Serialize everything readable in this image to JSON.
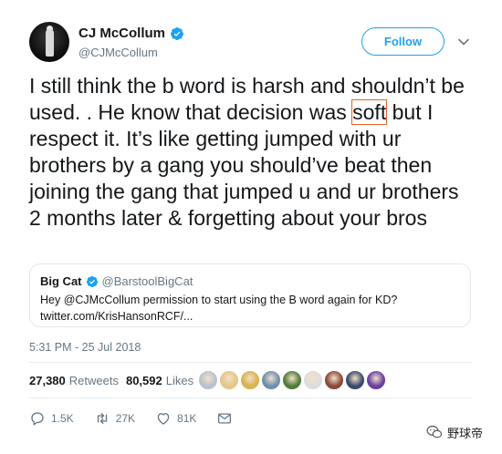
{
  "author": {
    "display_name": "CJ McCollum",
    "handle": "@CJMcCollum",
    "verified": true
  },
  "follow_button": {
    "label": "Follow"
  },
  "tweet": {
    "text_before": "I still think the b word is harsh and shouldn’t be used. . He know that decision was ",
    "highlighted_word": "soft",
    "text_after": " but I respect it. It’s like getting jumped with ur brothers by a gang you should’ve beat then joining the gang that jumped u and ur brothers 2 months later & forgetting about your bros",
    "highlight_color": "#e8622a"
  },
  "quoted_tweet": {
    "display_name": "Big Cat",
    "handle": "@BarstoolBigCat",
    "verified": true,
    "text_line1": "Hey @CJMcCollum permission to start using the B word again for KD?",
    "text_line2": "twitter.com/KrisHansonRCF/..."
  },
  "timestamp": "5:31 PM - 25 Jul 2018",
  "stats": {
    "retweets_count": "27,380",
    "retweets_label": "Retweets",
    "likes_count": "80,592",
    "likes_label": "Likes"
  },
  "likers": [
    {
      "icon": "liker-avatar",
      "color": "#b8c2cc"
    },
    {
      "icon": "liker-avatar",
      "color": "#e3c68a"
    },
    {
      "icon": "liker-avatar",
      "color": "#d9b24c"
    },
    {
      "icon": "liker-avatar",
      "color": "#6e8fb0"
    },
    {
      "icon": "liker-avatar",
      "color": "#4f7d3a"
    },
    {
      "icon": "liker-avatar",
      "color": "#dddddd"
    },
    {
      "icon": "liker-avatar",
      "color": "#8a4a3a"
    },
    {
      "icon": "liker-avatar",
      "color": "#3b4a6b"
    },
    {
      "icon": "liker-avatar",
      "color": "#6a3fa0"
    }
  ],
  "actions": {
    "reply_count": "1.5K",
    "retweet_count": "27K",
    "like_count": "81K"
  },
  "watermark": {
    "text": "野球帝"
  },
  "colors": {
    "accent": "#1da1f2",
    "text": "#14171a",
    "muted": "#657786"
  }
}
